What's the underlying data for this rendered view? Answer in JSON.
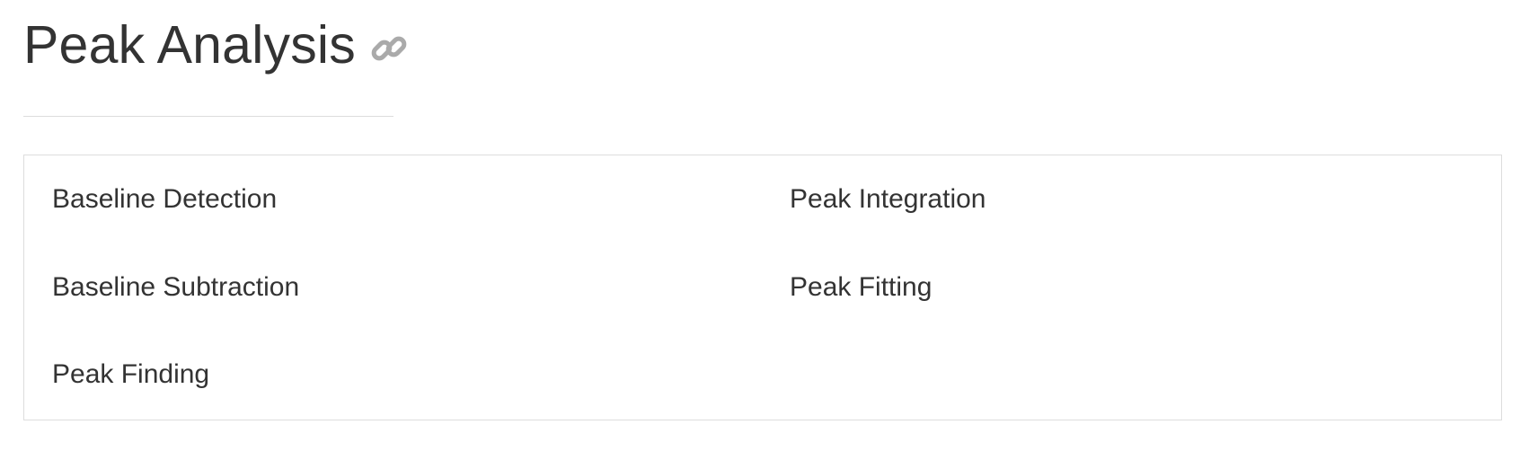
{
  "header": {
    "title": "Peak Analysis",
    "link_icon": "link-icon"
  },
  "panel": {
    "left_items": [
      {
        "label": "Baseline Detection"
      },
      {
        "label": "Baseline Subtraction"
      },
      {
        "label": "Peak Finding"
      }
    ],
    "right_items": [
      {
        "label": "Peak Integration"
      },
      {
        "label": "Peak Fitting"
      }
    ]
  },
  "colors": {
    "text": "#333333",
    "icon": "#aaaaaa",
    "border": "#dddddd",
    "background": "#ffffff"
  }
}
